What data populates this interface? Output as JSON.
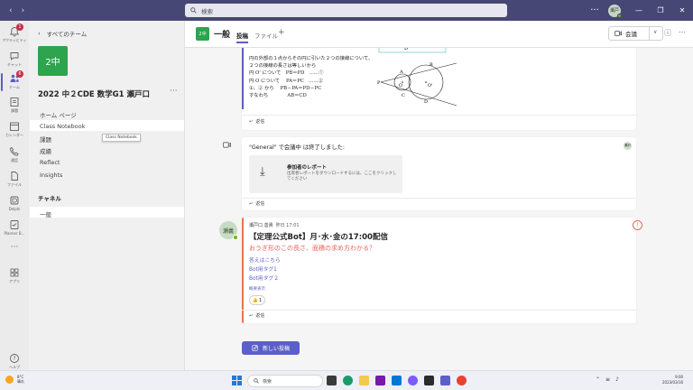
{
  "window": {
    "search_placeholder": "検索",
    "avatar_initials": "瀬戸",
    "more": "···"
  },
  "rail": {
    "items": [
      {
        "label": "アクティビティ",
        "icon": "bell-icon",
        "badge": "1"
      },
      {
        "label": "チャット",
        "icon": "chat-icon"
      },
      {
        "label": "チーム",
        "icon": "teams-icon",
        "badge": "6"
      },
      {
        "label": "課題",
        "icon": "assignment-icon"
      },
      {
        "label": "カレンダー",
        "icon": "calendar-icon"
      },
      {
        "label": "通話",
        "icon": "phone-icon"
      },
      {
        "label": "ファイル",
        "icon": "file-icon"
      },
      {
        "label": "Delphi",
        "icon": "delphi-icon"
      },
      {
        "label": "Planner B...",
        "icon": "planner-icon"
      },
      {
        "label": "···",
        "icon": "more-icon"
      },
      {
        "label": "アプリ",
        "icon": "apps-icon"
      },
      {
        "label": "ヘルプ",
        "icon": "help-icon"
      }
    ]
  },
  "panel": {
    "back_label": "すべてのチーム",
    "team_logo": "2中",
    "team_name": "2022 中２CDE 数学G1 瀬戸口",
    "more": "···",
    "nav": [
      "ホーム ページ",
      "Class Notebook",
      "課題",
      "成績",
      "Reflect",
      "Insights"
    ],
    "tooltip": "Class Notebook",
    "channels_title": "チャネル",
    "channels": [
      "一般"
    ]
  },
  "channel": {
    "icon_text": "2中",
    "name": "一般",
    "tabs": [
      "投稿",
      "ファイル"
    ],
    "add_tab": "+",
    "meet_label": "会議"
  },
  "feed": {
    "math_lines": [
      "円の外部の１点からその円に引いた２つの接線について、",
      "２つの接線の長さは等しいから",
      "円 O' について　PB＝PD　……①",
      "円 O について　 PA＝PC　……②",
      "①、② から　 PB－PA＝PD－PC",
      "すなわち　　　　AB＝CD"
    ],
    "diagram_labels": {
      "b": "B",
      "a": "A",
      "p": "P",
      "o": "O",
      "o2": "O'",
      "c": "C",
      "d": "D",
      "d_top": "D"
    },
    "reply_label": "返信",
    "meeting_ended": "\"General\" で会議中 は終了しました:",
    "report_title": "参加者のレポート",
    "report_desc": "出席者レポートをダウンロードするには、ここをクリックしてください",
    "system_avatar": "瀬戸",
    "post": {
      "author": "瀬戸口 善貴",
      "time": "昨日 17:01",
      "avatar": "瀬義",
      "title": "【定理公式Bot】月･水･金の17:00配信",
      "question": "おうぎ形のこの長さ、面積の求め方わかる？",
      "links": [
        "答えはこちら",
        "Bot用タグ1",
        "Bot用タグ２"
      ],
      "show_more": "概要表示",
      "reaction_emoji": "👍",
      "reaction_count": "1",
      "urgent": "!"
    },
    "new_post": "新しい投稿"
  },
  "taskbar": {
    "temp": "8°C",
    "weather": "晴れ",
    "search": "検索",
    "time": "9:00",
    "date": "2023/03/16"
  },
  "colors": {
    "titlebar": "#464775",
    "accent": "#5b5fc7",
    "team_green": "#2da44e",
    "post_accent": "#e97548",
    "question_red": "#e8645e"
  }
}
